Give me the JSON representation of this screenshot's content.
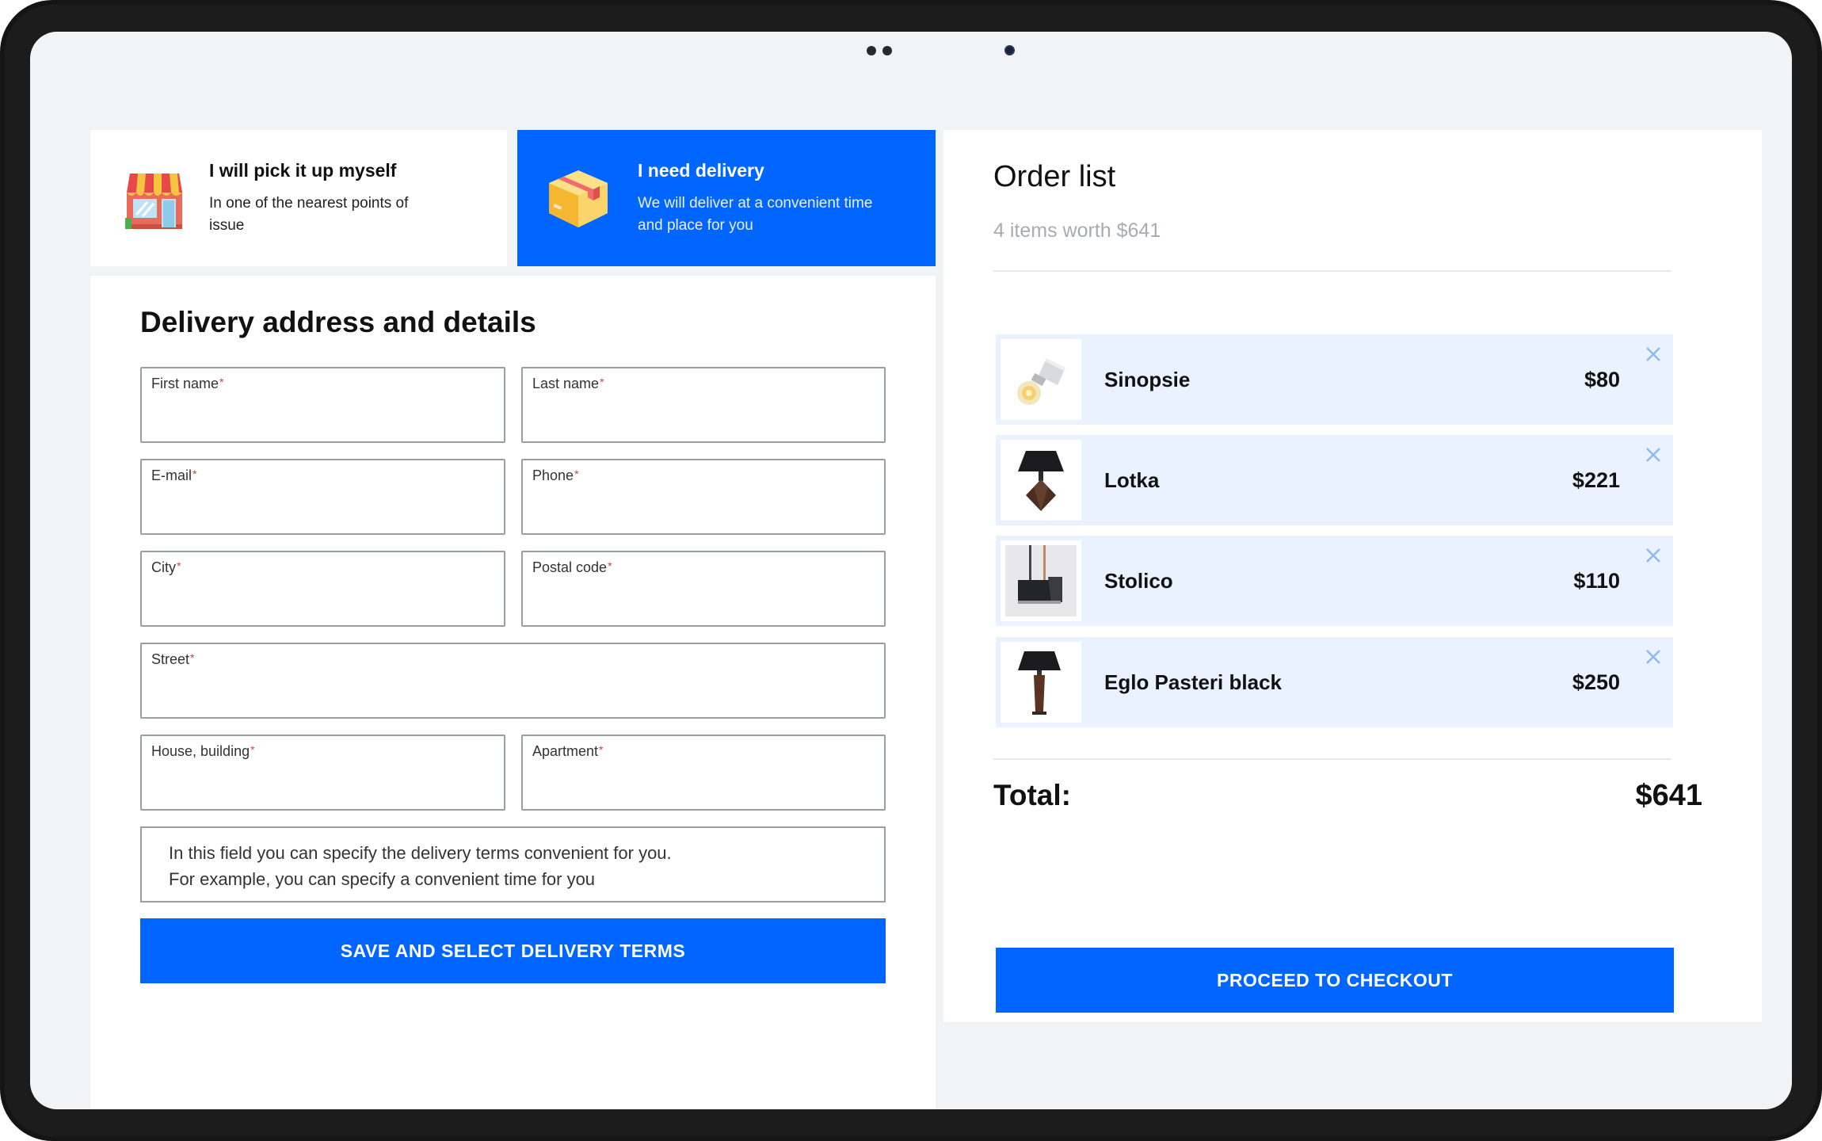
{
  "delivery_options": {
    "pickup": {
      "title": "I will pick it up myself",
      "description": "In one of the nearest points of issue",
      "selected": false
    },
    "delivery": {
      "title": "I need delivery",
      "description": "We will deliver at a convenient time and place for you",
      "selected": true
    }
  },
  "form": {
    "title": "Delivery address and details",
    "fields": {
      "first_name": "First name",
      "last_name": "Last name",
      "email": "E-mail",
      "phone": "Phone",
      "city": "City",
      "postal_code": "Postal code",
      "street": "Street",
      "house": "House, building",
      "apartment": "Apartment"
    },
    "required_mark": "*",
    "notes_placeholder": "In this field you can specify the delivery terms convenient for you.\nFor example, you can specify a convenient time for you",
    "save_button": "SAVE AND SELECT DELIVERY TERMS"
  },
  "order": {
    "title": "Order list",
    "summary": "4 items worth $641",
    "items": [
      {
        "name": "Sinopsie",
        "price": "$80",
        "icon": "bulb-lamp-icon"
      },
      {
        "name": "Lotka",
        "price": "$221",
        "icon": "table-lamp-icon"
      },
      {
        "name": "Stolico",
        "price": "$110",
        "icon": "pendant-lamp-icon"
      },
      {
        "name": "Eglo Pasteri black",
        "price": "$250",
        "icon": "floor-lamp-icon"
      }
    ],
    "total_label": "Total:",
    "total_value": "$641",
    "checkout_button": "PROCEED TO CHECKOUT"
  },
  "colors": {
    "accent": "#0066ff",
    "item_bg": "#ebf2ff",
    "required": "#e8373a",
    "muted": "#a7abb2",
    "screen_bg": "#f2f3f5"
  }
}
